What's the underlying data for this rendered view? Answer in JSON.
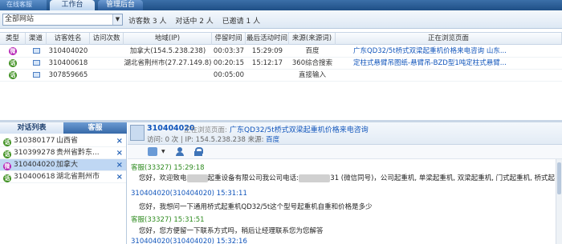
{
  "app": {
    "logo_text": "在线客服",
    "tabs": [
      "工作台",
      "管理后台"
    ]
  },
  "toolbar": {
    "site_select": "全部网站",
    "visitor_count": "访客数 3 人",
    "in_chat": "对话中 2 人",
    "queued": "已邀请 1 人"
  },
  "table": {
    "headers": [
      "类型",
      "渠道",
      "访客姓名",
      "访问次数",
      "地域(IP)",
      "停留时间",
      "最后活动时间",
      "来源(来源词)",
      "正在浏览页面"
    ],
    "rows": [
      {
        "type": "微",
        "id": "310404020",
        "visits": "",
        "region": "加拿大(154.5.238.238)",
        "stay": "00:03:37",
        "last": "15:29:09",
        "source": "百度",
        "page": "广东QD32/5t桥式双梁起重机价格来电咨询 山东..."
      },
      {
        "type": "话",
        "id": "310400618",
        "visits": "",
        "region": "湖北省荆州市(27.27.149.8)",
        "stay": "00:20:15",
        "last": "15:12:17",
        "source": "360综合搜索",
        "page": "定柱式悬臂吊图纸-悬臂吊-BZD型1吨定柱式悬臂..."
      },
      {
        "type": "话",
        "id": "307859665",
        "visits": "",
        "region": "",
        "stay": "00:05:00",
        "last": "",
        "source": "直接输入",
        "page": ""
      }
    ]
  },
  "left_panel": {
    "tabs": [
      "对话列表",
      "客服"
    ],
    "items": [
      {
        "id": "310380177",
        "loc": "山西省",
        "icon": "话"
      },
      {
        "id": "310399278",
        "loc": "贵州省黔东...",
        "icon": "话"
      },
      {
        "id": "310404020",
        "loc": "加拿大",
        "icon": "微",
        "active": true
      },
      {
        "id": "310400618",
        "loc": "湖北省荆州市",
        "icon": "话"
      }
    ]
  },
  "chat": {
    "visitor_id": "310404020",
    "now_label": "正在浏览页面:",
    "now_page": "广东QD32/5t桥式双梁起重机价格来电咨询",
    "info_visits": "访问: 0 次",
    "info_ip": "IP: 154.5.238.238",
    "info_ref_label": "来源:",
    "info_ref": "百度",
    "messages": [
      {
        "who": "agent",
        "header": "(33327) 15:29:18",
        "name": "客服",
        "body_a": "您好，欢迎致电",
        "body_b": "起重设备有限公司我公司电话:",
        "body_c": "31 (微信同号)，公司起重机, 单梁起重机, 双梁起重机, 门式起重机, 桥式起重机，欢迎咨询"
      },
      {
        "who": "visitor",
        "header": "310404020(310404020)  15:31:11",
        "body": "您好，我想问一下通用桥式起重机QD32/5t这个型号起重机自重和价格是多少"
      },
      {
        "who": "agent",
        "header": "(33327) 15:31:51",
        "name": "客服",
        "body": "您好，您方便留一下联系方式吗，稍后让经理联系您为您解答"
      },
      {
        "who": "visitor",
        "header": "310404020(310404020)  15:32:16",
        "body": ""
      }
    ]
  }
}
